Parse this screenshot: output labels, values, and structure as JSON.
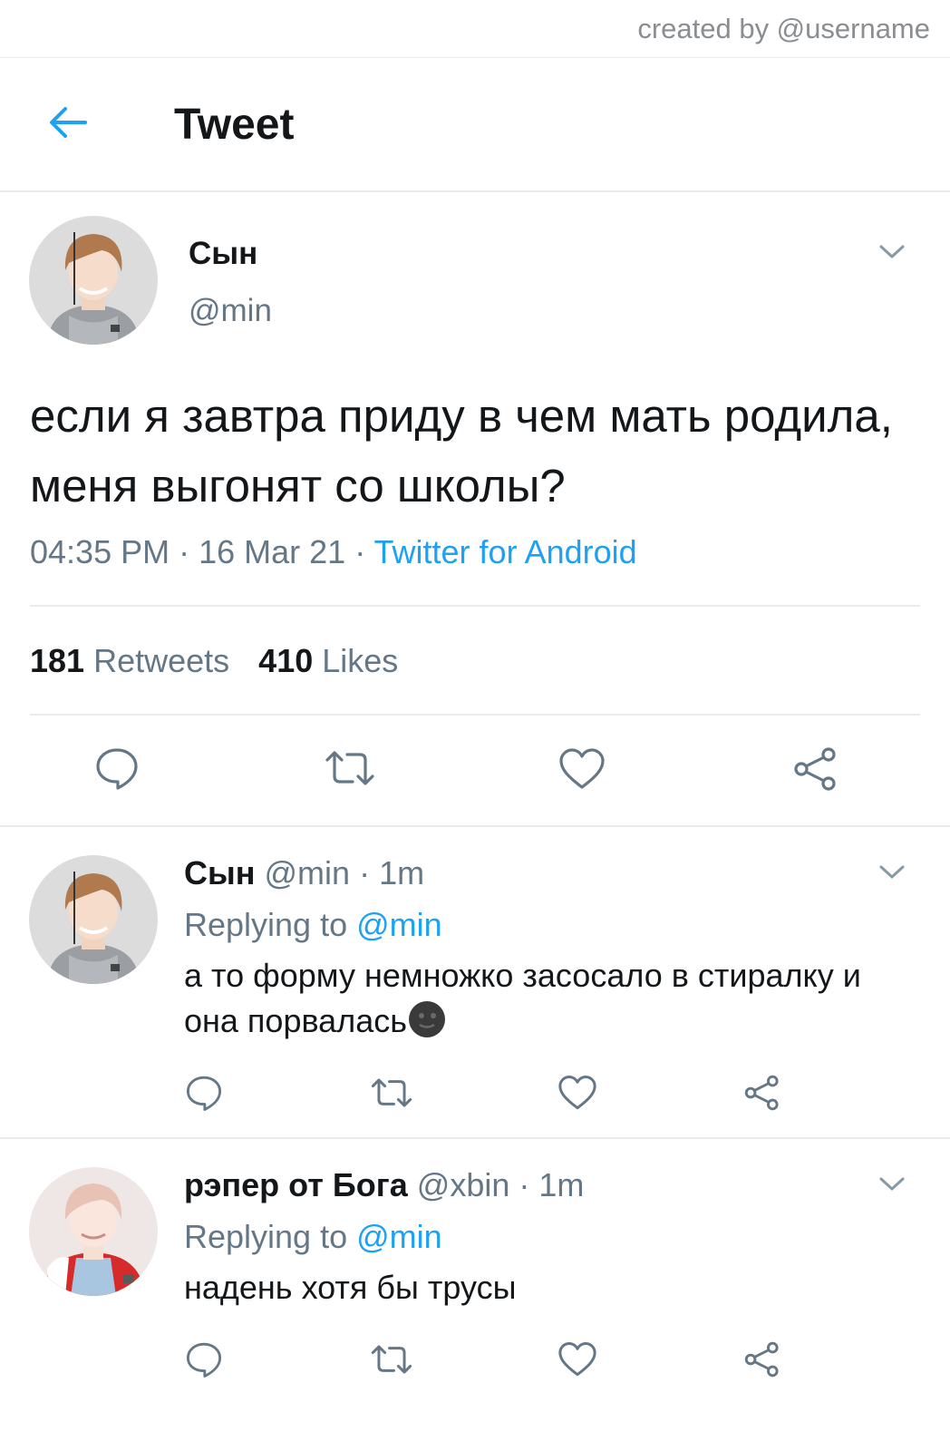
{
  "credit": "created by @username",
  "header": {
    "title": "Tweet"
  },
  "tweet": {
    "name": "Сын",
    "handle": "@min",
    "text": "если я завтра приду в чем мать родила, меня выгонят со школы?",
    "time": "04:35 PM",
    "date": "16 Mar 21",
    "dot": " · ",
    "source": "Twitter for Android",
    "retweets_count": "181",
    "retweets_label": "Retweets",
    "likes_count": "410",
    "likes_label": "Likes"
  },
  "replies": [
    {
      "name": "Сын",
      "handle": "@min",
      "time": "1m",
      "replying_label": "Replying to",
      "replying_to": "@min",
      "text": "а то форму немножко засосало в стиралку и она порвалась",
      "emoji": "new-moon-face-emoji"
    },
    {
      "name": "рэпер от Бога",
      "handle": "@xbin",
      "time": "1m",
      "replying_label": "Replying to",
      "replying_to": "@min",
      "text": "надень хотя бы трусы"
    }
  ],
  "colors": {
    "accent": "#1da1f2",
    "muted": "#657786",
    "text": "#14171a",
    "divider": "#e6ecf0",
    "icon": "#657786"
  },
  "icons": [
    "back-arrow-icon",
    "chevron-down-icon",
    "reply-icon",
    "retweet-icon",
    "like-icon",
    "share-icon"
  ]
}
